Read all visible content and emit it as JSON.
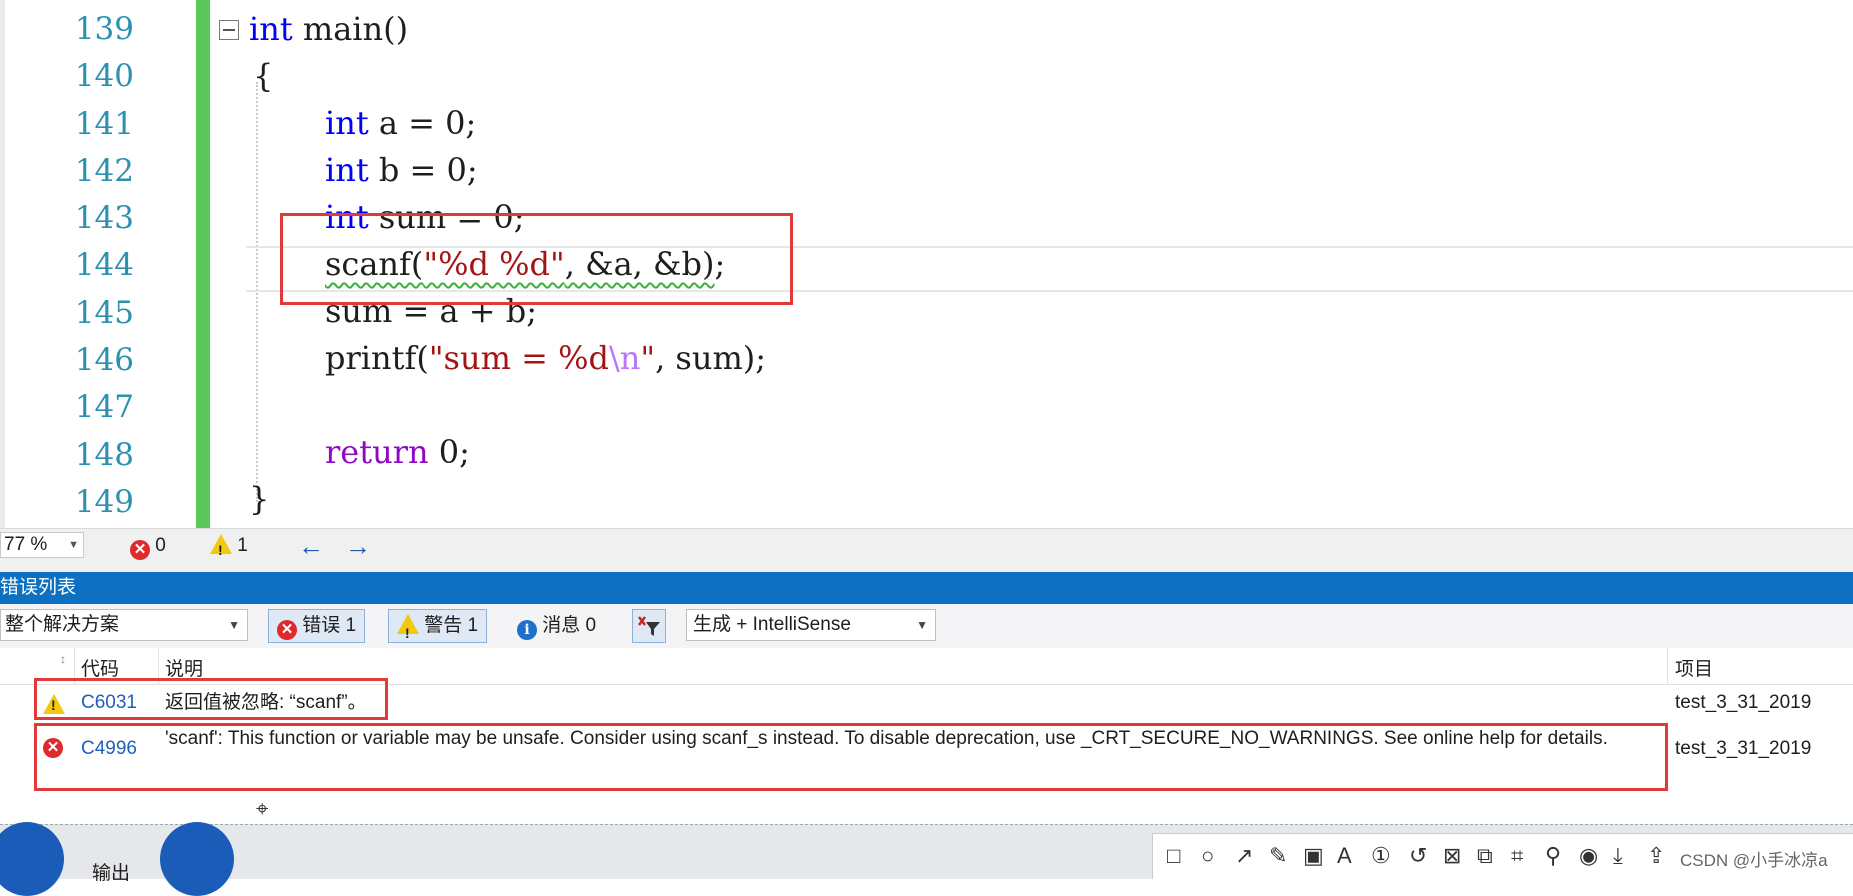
{
  "editor": {
    "line_numbers": [
      "139",
      "140",
      "141",
      "142",
      "143",
      "144",
      "145",
      "146",
      "147",
      "148",
      "149"
    ],
    "code": {
      "l139_kw": "int",
      "l139_rest": " main()",
      "l140": "{",
      "l141_kw": "int",
      "l141_rest": " a = 0;",
      "l142_kw": "int",
      "l142_rest": " b = 0;",
      "l143_kw": "int",
      "l143_rest": " sum = 0;",
      "l144_fn": "scanf(",
      "l144_str": "\"%d %d\"",
      "l144_args": ", &a, &b)",
      "l144_end": ";",
      "l145": "sum = a + b;",
      "l146_fn": "printf(",
      "l146_str1": "\"sum = %d",
      "l146_esc": "\\n",
      "l146_str2": "\"",
      "l146_end": ", sum);",
      "l148_kw": "return",
      "l148_rest": " 0;",
      "l149": "}"
    }
  },
  "status": {
    "zoom": "77 %",
    "errors": "0",
    "warnings": "1"
  },
  "error_list": {
    "title": "错误列表",
    "scope": "整个解决方案",
    "filter_errors": "错误 1",
    "filter_warnings": "警告 1",
    "filter_messages": "消息 0",
    "source": "生成 + IntelliSense",
    "columns": {
      "code": "代码",
      "desc": "说明",
      "project": "项目"
    },
    "rows": [
      {
        "code": "C6031",
        "desc": "返回值被忽略: “scanf”。",
        "project": "test_3_31_2019",
        "severity": "warning"
      },
      {
        "code": "C4996",
        "desc": "'scanf': This function or variable may be unsafe. Consider using scanf_s instead. To disable deprecation, use _CRT_SECURE_NO_WARNINGS. See online help for details.",
        "project": "test_3_31_2019",
        "severity": "error"
      }
    ]
  },
  "bottom": {
    "output_tab": "输出",
    "watermark": "CSDN @小手冰凉a"
  },
  "colors": {
    "accent": "#0e70c0",
    "highlight_box": "#e03a3a",
    "keyword": "#0000ff",
    "string": "#a31515"
  }
}
